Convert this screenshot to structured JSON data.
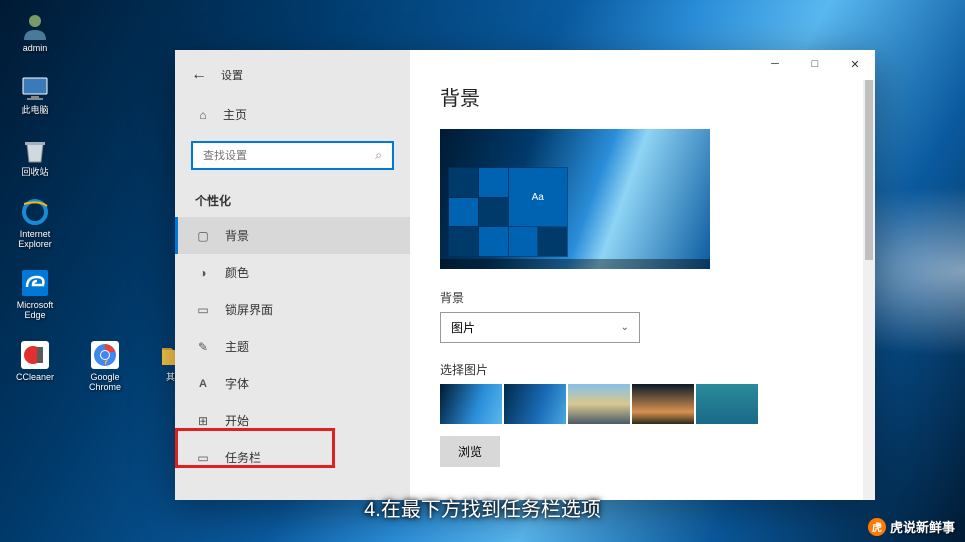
{
  "desktop": {
    "icons": [
      {
        "name": "admin",
        "label": "admin"
      },
      {
        "name": "this-pc",
        "label": "此电脑"
      },
      {
        "name": "recycle-bin",
        "label": "回收站"
      },
      {
        "name": "ie",
        "label": "Internet Explorer"
      },
      {
        "name": "edge",
        "label": "Microsoft Edge"
      },
      {
        "name": "ccleaner",
        "label": "CCleaner"
      },
      {
        "name": "chrome",
        "label": "Google Chrome"
      },
      {
        "name": "other",
        "label": "其他"
      }
    ]
  },
  "window": {
    "title": "设置",
    "home": "主页",
    "search_placeholder": "查找设置",
    "category": "个性化",
    "nav": [
      {
        "key": "background",
        "label": "背景",
        "active": true
      },
      {
        "key": "colors",
        "label": "颜色"
      },
      {
        "key": "lockscreen",
        "label": "锁屏界面"
      },
      {
        "key": "themes",
        "label": "主题"
      },
      {
        "key": "fonts",
        "label": "字体"
      },
      {
        "key": "start",
        "label": "开始"
      },
      {
        "key": "taskbar",
        "label": "任务栏"
      }
    ],
    "content": {
      "page_title": "背景",
      "preview_sample": "Aa",
      "bg_label": "背景",
      "bg_value": "图片",
      "choose_label": "选择图片",
      "browse": "浏览"
    }
  },
  "caption": "4.在最下方找到任务栏选项",
  "watermark": {
    "logo": "虎",
    "text": "虎说新鲜事"
  }
}
